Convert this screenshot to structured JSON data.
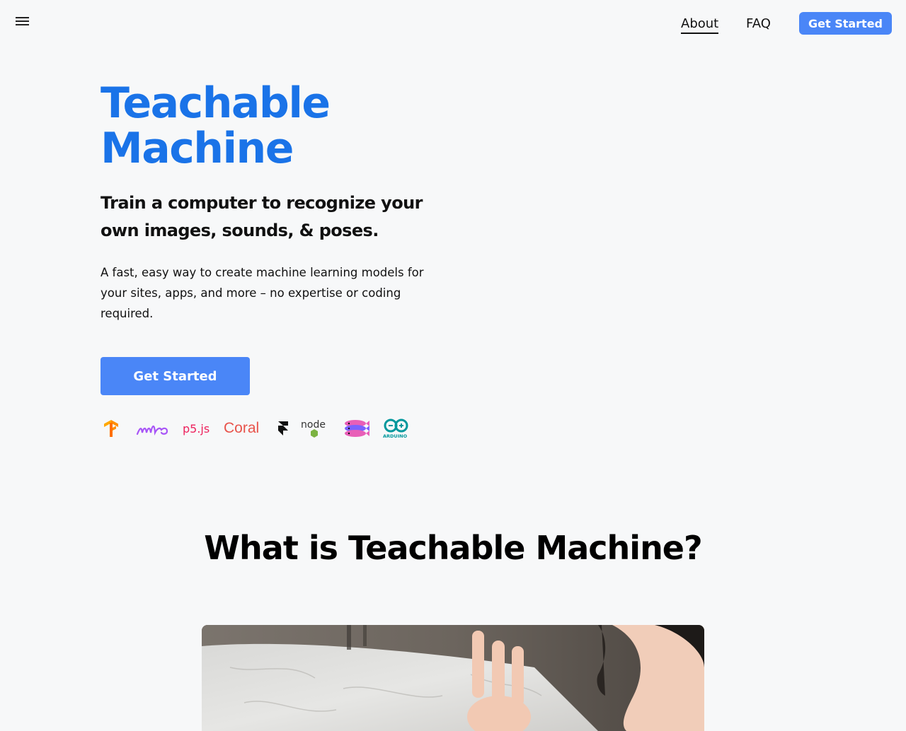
{
  "nav": {
    "about": "About",
    "faq": "FAQ",
    "cta": "Get Started"
  },
  "hero": {
    "title_line1": "Teachable",
    "title_line2": "Machine",
    "subtitle": "Train a computer to recognize your own images, sounds, & poses.",
    "description": "A fast, easy way to create machine learning models for your sites, apps, and more – no expertise or coding required.",
    "cta": "Get Started"
  },
  "partners": {
    "items": [
      {
        "name": "tensorflow-logo",
        "text": ""
      },
      {
        "name": "ml5-logo",
        "text": "ml5"
      },
      {
        "name": "p5js-logo",
        "text": "p5.js"
      },
      {
        "name": "coral-logo",
        "text": "Coral"
      },
      {
        "name": "framer-logo",
        "text": ""
      },
      {
        "name": "node-logo",
        "text": "node"
      },
      {
        "name": "glitch-logo",
        "text": ""
      },
      {
        "name": "arduino-logo",
        "text": "ARDUINO"
      }
    ]
  },
  "about_section": {
    "title": "What is Teachable Machine?"
  },
  "colors": {
    "brand_blue": "#1a73e8",
    "button_blue": "#4a86f7",
    "background": "#f7f8f9"
  }
}
